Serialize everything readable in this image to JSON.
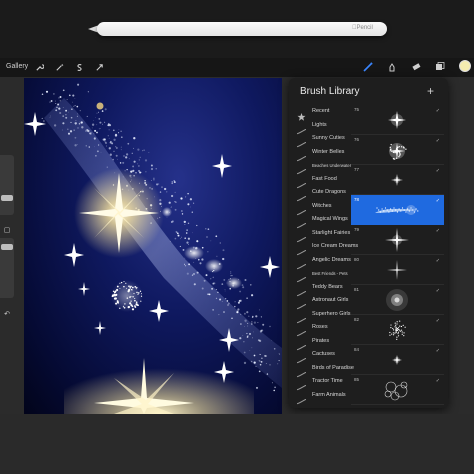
{
  "pencil": {
    "brand": "Pencil"
  },
  "toolbar": {
    "gallery_label": "Gallery",
    "left_icons": [
      "wrench-icon",
      "magic-wand-icon",
      "selection-icon",
      "transform-arrow-icon"
    ],
    "right_icons": [
      "brush-icon",
      "smudge-icon",
      "eraser-icon",
      "layers-icon"
    ],
    "current_color": "#f4ecb0",
    "brush_tool_color": "#3a86ff"
  },
  "side": {
    "undo_label": "↶",
    "modify_label": "▢"
  },
  "brush_library": {
    "title": "Brush Library",
    "add_label": "+",
    "categories": [
      {
        "label": "Recent",
        "icon": "star-icon"
      },
      {
        "label": "Lights",
        "icon": "brush-stroke-icon"
      },
      {
        "label": "Sunny Cuties",
        "icon": "brush-stroke-icon"
      },
      {
        "label": "Winter Belles",
        "icon": "brush-stroke-icon"
      },
      {
        "label": "Beaches Underwater",
        "icon": "brush-stroke-icon"
      },
      {
        "label": "Fast Food",
        "icon": "brush-stroke-icon"
      },
      {
        "label": "Cute Dragons",
        "icon": "brush-stroke-icon"
      },
      {
        "label": "Witches",
        "icon": "brush-stroke-icon"
      },
      {
        "label": "Magical Wings",
        "icon": "brush-stroke-icon"
      },
      {
        "label": "Starlight Fairies",
        "icon": "brush-stroke-icon"
      },
      {
        "label": "Ice Cream Dreams",
        "icon": "brush-stroke-icon"
      },
      {
        "label": "Angelic Dreams",
        "icon": "brush-stroke-icon"
      },
      {
        "label": "Best Friends - Pets",
        "icon": "brush-stroke-icon"
      },
      {
        "label": "Teddy Bears",
        "icon": "brush-stroke-icon"
      },
      {
        "label": "Astronaut Girls",
        "icon": "brush-stroke-icon"
      },
      {
        "label": "Superhero Girls",
        "icon": "brush-stroke-icon"
      },
      {
        "label": "Roses",
        "icon": "brush-stroke-icon"
      },
      {
        "label": "Pirates",
        "icon": "brush-stroke-icon"
      },
      {
        "label": "Cactuses",
        "icon": "brush-stroke-icon"
      },
      {
        "label": "Birds of Paradise",
        "icon": "brush-stroke-icon"
      },
      {
        "label": "Tractor Time",
        "icon": "brush-stroke-icon"
      },
      {
        "label": "Farm Animals",
        "icon": "brush-stroke-icon"
      }
    ],
    "brushes": [
      {
        "number": "75",
        "preview": "four-point-sparkle",
        "selected": false
      },
      {
        "number": "76",
        "preview": "glitter-burst",
        "selected": false
      },
      {
        "number": "77",
        "preview": "small-star",
        "selected": false
      },
      {
        "number": "78",
        "preview": "comet-stroke",
        "selected": true
      },
      {
        "number": "79",
        "preview": "long-ray-star",
        "selected": false
      },
      {
        "number": "80",
        "preview": "thin-ray-star",
        "selected": false
      },
      {
        "number": "81",
        "preview": "soft-glow",
        "selected": false
      },
      {
        "number": "82",
        "preview": "sparkle-cluster",
        "selected": false
      },
      {
        "number": "84",
        "preview": "tiny-star",
        "selected": false
      },
      {
        "number": "85",
        "preview": "bubbles",
        "selected": false
      }
    ],
    "selected_color": "#1f6ae0"
  }
}
